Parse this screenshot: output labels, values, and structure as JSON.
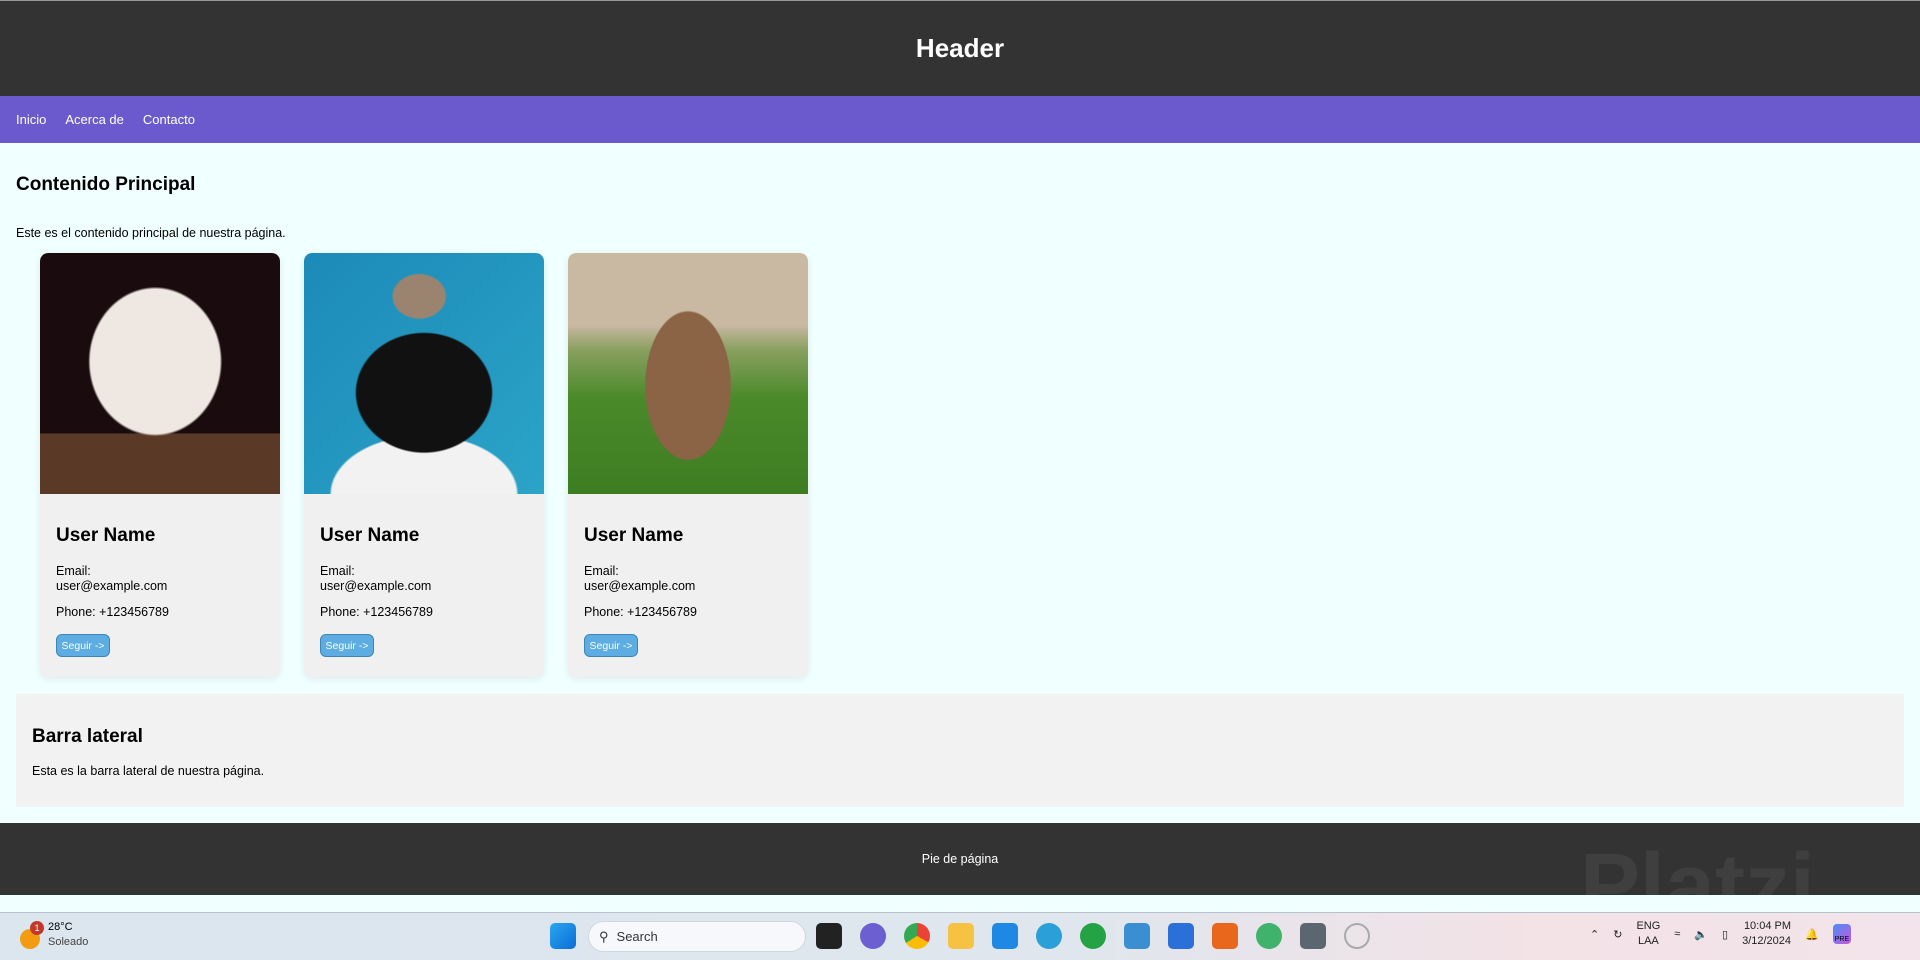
{
  "header": {
    "title": "Header"
  },
  "nav": {
    "items": [
      "Inicio",
      "Acerca de",
      "Contacto"
    ]
  },
  "main": {
    "title": "Contenido Principal",
    "text": "Este es el contenido principal de nuestra página.",
    "cards": [
      {
        "image": "kitten-photo",
        "name": "User Name",
        "email_label": "Email:",
        "email": "user@example.com",
        "phone": "Phone: +123456789",
        "button": "Seguir ->"
      },
      {
        "image": "dog-and-cat-photo",
        "name": "User Name",
        "email_label": "Email:",
        "email": "user@example.com",
        "phone": "Phone: +123456789",
        "button": "Seguir ->"
      },
      {
        "image": "rabbit-photo",
        "name": "User Name",
        "email_label": "Email:",
        "email": "user@example.com",
        "phone": "Phone: +123456789",
        "button": "Seguir ->"
      }
    ]
  },
  "sidebar": {
    "title": "Barra lateral",
    "text": "Esta es la barra lateral de nuestra página."
  },
  "footer": {
    "text": "Pie de página"
  },
  "watermark": "Platzi",
  "colors": {
    "header": "#333333",
    "nav": "#6a5acd",
    "main_bg": "#f0ffff",
    "card": "#f0f0f0",
    "button": "#5dade2"
  },
  "taskbar": {
    "weather": {
      "temp": "28°C",
      "condition": "Soleado",
      "badge": "1"
    },
    "search_placeholder": "Search",
    "lang": "ENG",
    "layout": "LAA",
    "time": "10:04 PM",
    "date": "3/12/2024",
    "copilot_badge": "PRE"
  }
}
